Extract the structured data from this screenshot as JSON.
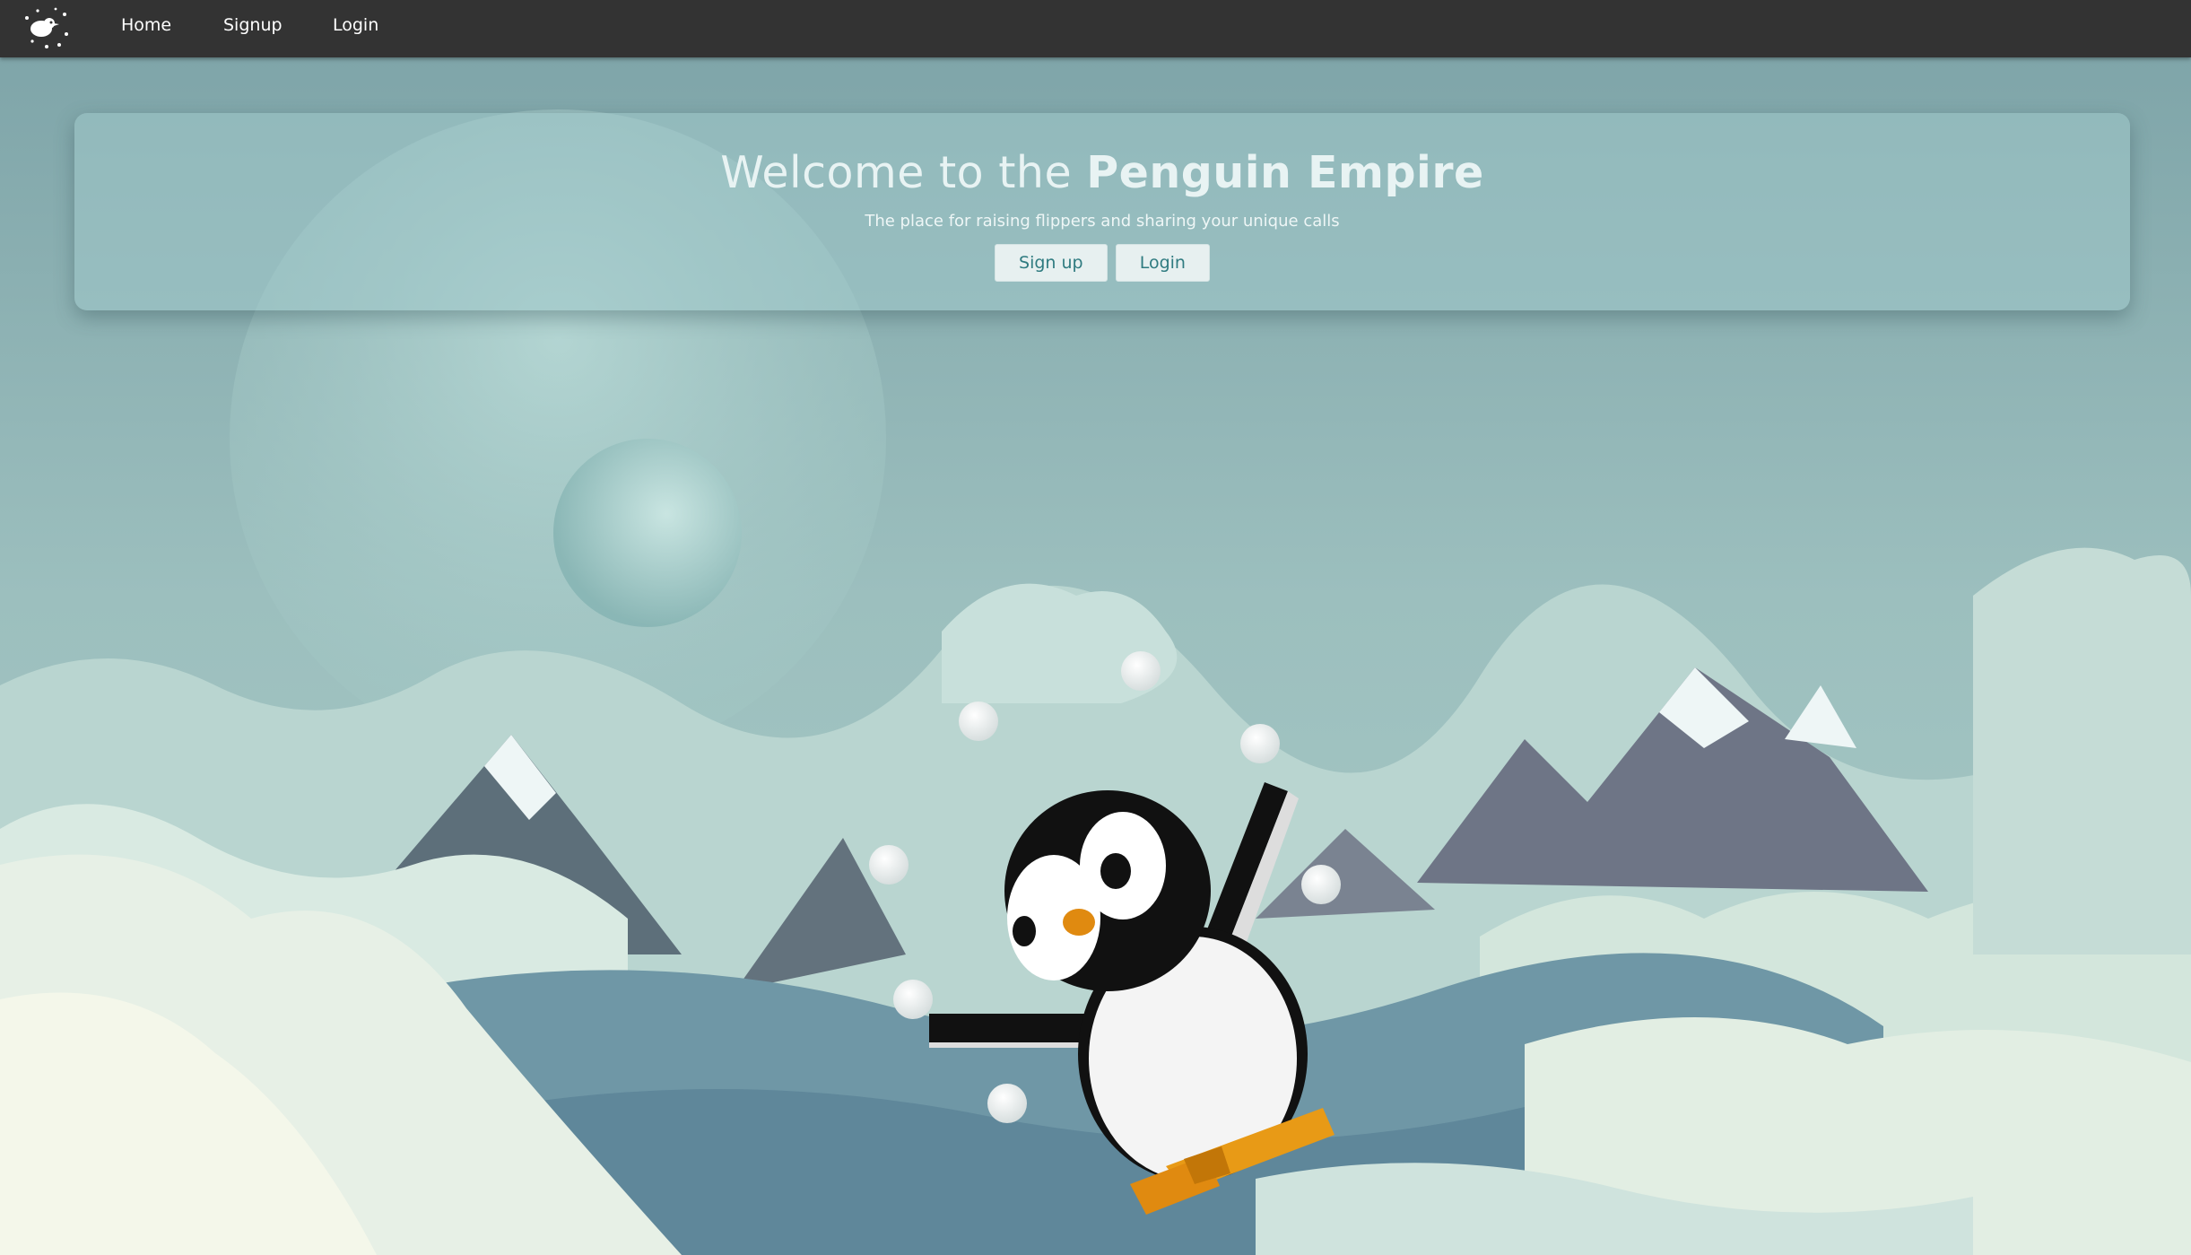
{
  "nav": {
    "logo_icon": "penguin-sparkle-logo-icon",
    "links": [
      "Home",
      "Signup",
      "Login"
    ]
  },
  "hero": {
    "title_prefix": "Welcome to the ",
    "title_bold": "Penguin Empire",
    "subtitle": "The place for raising flippers and sharing your unique calls",
    "signup_label": "Sign up",
    "login_label": "Login"
  },
  "colors": {
    "navbar": "#333333",
    "sky": "#8fb3b6",
    "button_text": "#2f7b80",
    "beak": "#e08a10"
  }
}
